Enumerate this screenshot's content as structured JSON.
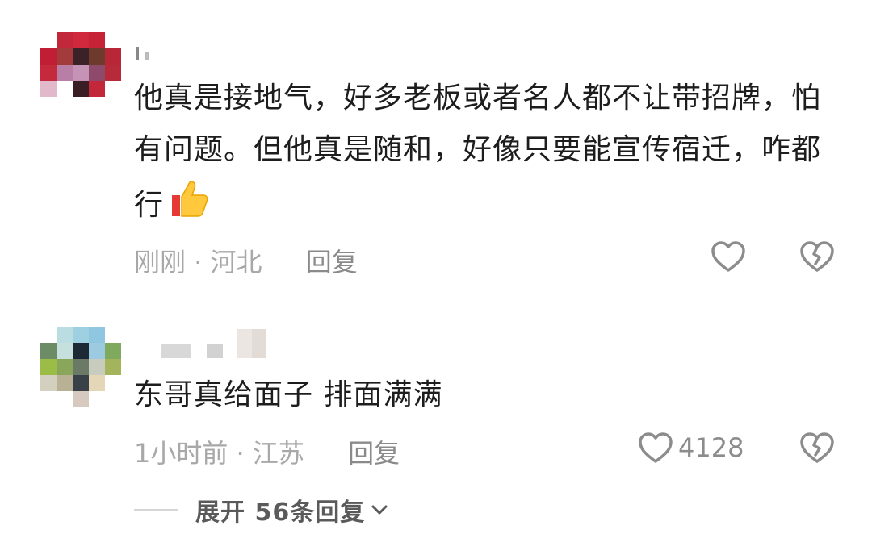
{
  "comments": [
    {
      "text": "他真是接地气，好多老板或者名人都不让带招牌，怕有问题。但他真是随和，好像只要能宣传宿迁，咋都行",
      "time_location": "刚刚 · 河北",
      "reply_label": "回复",
      "like_count": ""
    },
    {
      "text": "东哥真给面子 排面满满",
      "time_location": "1小时前 · 江苏",
      "reply_label": "回复",
      "like_count": "4128"
    }
  ],
  "expand_replies": "展开 56条回复",
  "icons": {
    "like": "heart-outline-icon",
    "dislike": "broken-heart-icon",
    "thumbs_up_emoji": "thumbs-up-emoji",
    "expand": "chevron-down-icon"
  },
  "colors": {
    "text_primary": "#1d1d1d",
    "text_meta": "#a8a8a8",
    "icon": "#8c8c8c"
  }
}
